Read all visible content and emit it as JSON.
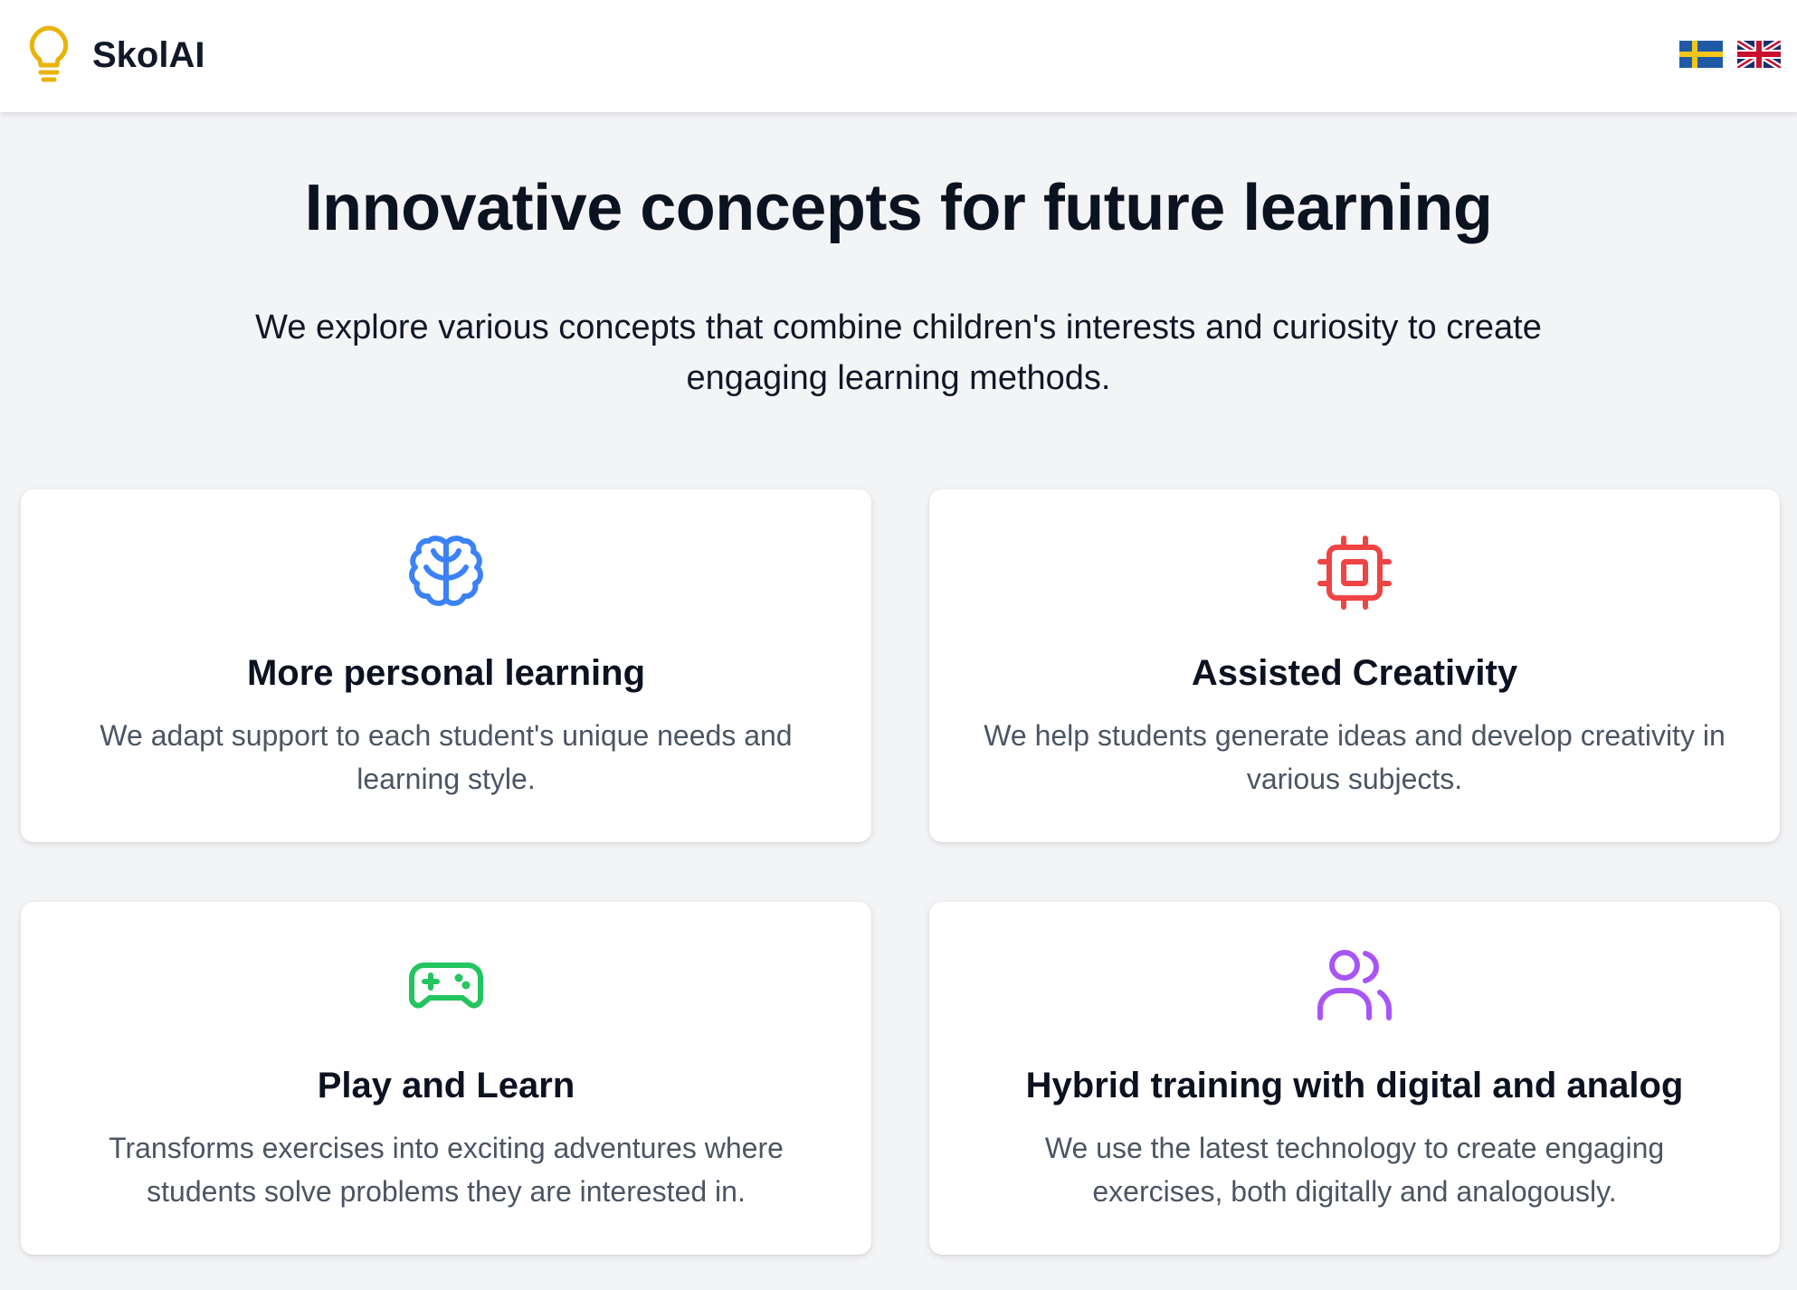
{
  "header": {
    "logo_icon": "lightbulb-icon",
    "brand": "SkolAI",
    "languages": [
      {
        "code": "sv",
        "icon": "flag-sweden-icon"
      },
      {
        "code": "en",
        "icon": "flag-uk-icon"
      }
    ]
  },
  "hero": {
    "title": "Innovative concepts for future learning",
    "subtitle": "We explore various concepts that combine children's interests and curiosity to create engaging learning methods."
  },
  "features": [
    {
      "icon": "brain-icon",
      "color": "#3b82f6",
      "title": "More personal learning",
      "description": "We adapt support to each student's unique needs and learning style."
    },
    {
      "icon": "cpu-chip-icon",
      "color": "#ef4444",
      "title": "Assisted Creativity",
      "description": "We help students generate ideas and develop creativity in various subjects."
    },
    {
      "icon": "gamepad-icon",
      "color": "#22c55e",
      "title": "Play and Learn",
      "description": "Transforms exercises into exciting adventures where students solve problems they are interested in."
    },
    {
      "icon": "users-icon",
      "color": "#a855f7",
      "title": "Hybrid training with digital and analog",
      "description": "We use the latest technology to create engaging exercises, both digitally and analogously."
    }
  ],
  "colors": {
    "background": "#f3f4f6",
    "card": "#ffffff",
    "logo_accent": "#eab308",
    "heading": "#0b1220",
    "body_text": "#4b5563"
  }
}
